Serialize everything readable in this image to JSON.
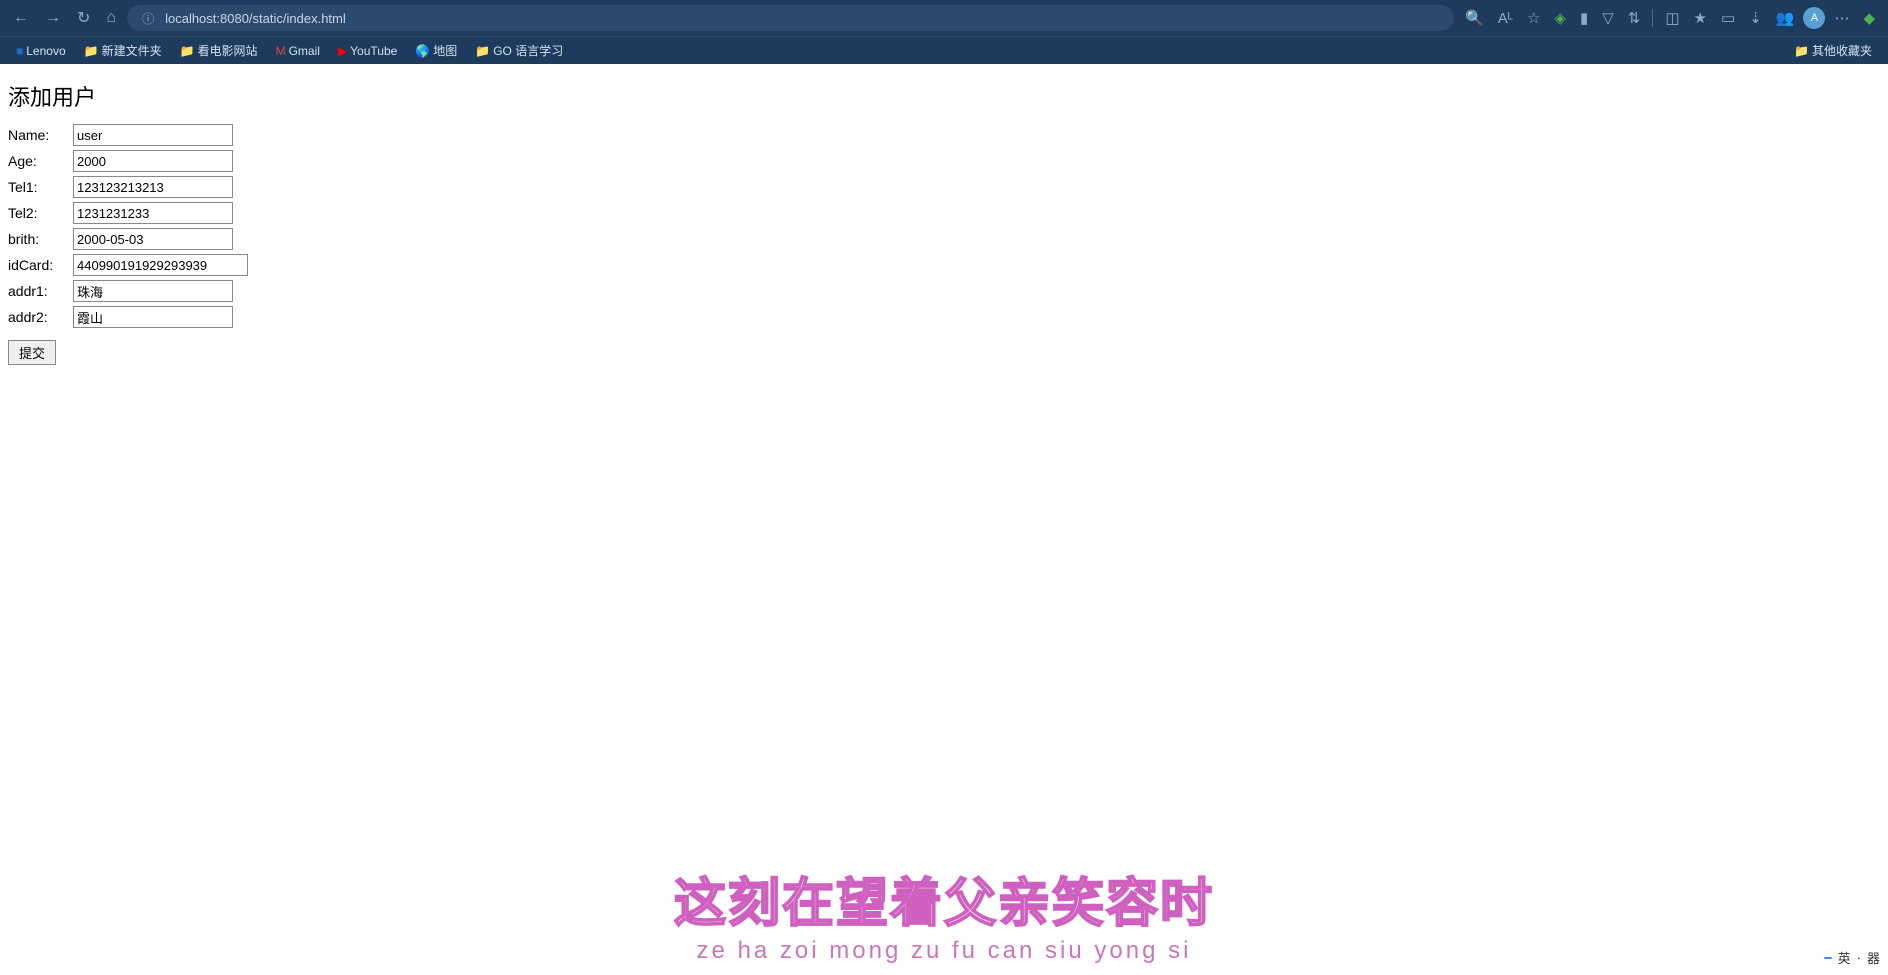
{
  "browser": {
    "url": "localhost:8080/static/index.html",
    "nav": {
      "back": "←",
      "forward": "→",
      "refresh": "↻",
      "home": "⌂"
    },
    "bookmarks": [
      {
        "id": "lenovo",
        "icon": "🖥",
        "label": "Lenovo",
        "color": "#1a6fc4"
      },
      {
        "id": "new-folder",
        "icon": "📁",
        "label": "新建文件夹",
        "color": "#f0c040"
      },
      {
        "id": "movie",
        "icon": "🎬",
        "label": "看电影网站",
        "color": "#f0c040"
      },
      {
        "id": "gmail",
        "icon": "✉",
        "label": "Gmail",
        "color": "#d44638"
      },
      {
        "id": "youtube",
        "icon": "▶",
        "label": "YouTube",
        "color": "#ff0000"
      },
      {
        "id": "maps",
        "icon": "🗺",
        "label": "地图",
        "color": "#4285f4"
      },
      {
        "id": "go-folder",
        "icon": "📁",
        "label": "GO 语言学习",
        "color": "#f0c040"
      }
    ],
    "other_bookmarks": "其他收藏夹"
  },
  "page": {
    "title": "添加用户",
    "form": {
      "name_label": "Name:",
      "name_value": "user",
      "age_label": "Age:",
      "age_value": "2000",
      "tel1_label": "Tel1:",
      "tel1_value": "123123213213",
      "tel2_label": "Tel2:",
      "tel2_value": "1231231233",
      "brith_label": "brith:",
      "brith_value": "2000-05-03",
      "idcard_label": "idCard:",
      "idcard_value": "440990191929293939",
      "addr1_label": "addr1:",
      "addr1_value": "珠海",
      "addr2_label": "addr2:",
      "addr2_value": "霞山",
      "submit_label": "提交"
    }
  },
  "lyrics": {
    "main": "这刻在望着父亲笑容时",
    "phonetic": "ze ha zoi mong zu fu can siu yong si"
  },
  "ime": {
    "icon": "英",
    "dots": "·",
    "settings": "器"
  }
}
